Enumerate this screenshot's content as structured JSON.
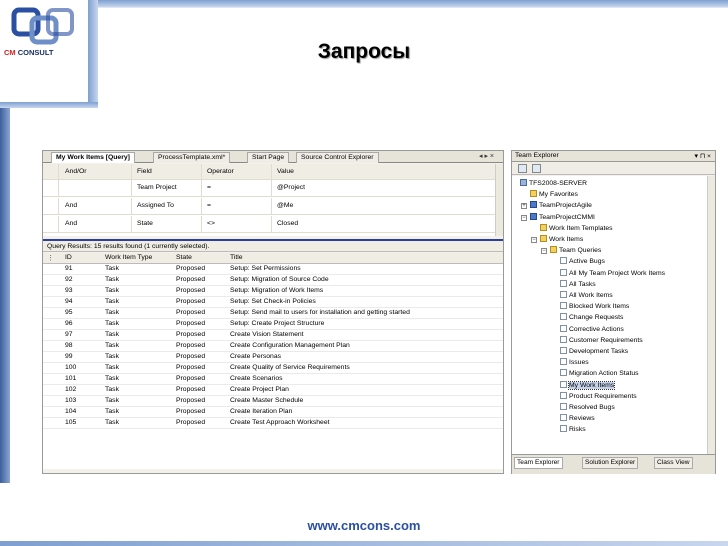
{
  "slide": {
    "title": "Запросы",
    "footer_url": "www.cmcons.com",
    "logo_text_cm": "CM",
    "logo_text_rest": " CONSULT"
  },
  "left_panel": {
    "tabs": [
      "My Work Items [Query]",
      "ProcessTemplate.xml*",
      "Start Page",
      "Source Control Explorer"
    ],
    "tab_controls": "◂ ▸ ×",
    "query_grid": {
      "headers": [
        "And/Or",
        "Field",
        "Operator",
        "Value"
      ],
      "rows": [
        [
          "",
          "Team Project",
          "=",
          "@Project"
        ],
        [
          "And",
          "Assigned To",
          "=",
          "@Me"
        ],
        [
          "And",
          "State",
          "<>",
          "Closed"
        ]
      ]
    },
    "results_summary": "Query Results: 15 results found (1 currently selected).",
    "results_headers": [
      "ID",
      "Work Item Type",
      "State",
      "Title"
    ],
    "results": [
      [
        "91",
        "Task",
        "Proposed",
        "Setup: Set Permissions"
      ],
      [
        "92",
        "Task",
        "Proposed",
        "Setup: Migration of Source Code"
      ],
      [
        "93",
        "Task",
        "Proposed",
        "Setup: Migration of Work Items"
      ],
      [
        "94",
        "Task",
        "Proposed",
        "Setup: Set Check-in Policies"
      ],
      [
        "95",
        "Task",
        "Proposed",
        "Setup: Send mail to users for installation and getting started"
      ],
      [
        "96",
        "Task",
        "Proposed",
        "Setup: Create Project Structure"
      ],
      [
        "97",
        "Task",
        "Proposed",
        "Create Vision Statement"
      ],
      [
        "98",
        "Task",
        "Proposed",
        "Create Configuration Management Plan"
      ],
      [
        "99",
        "Task",
        "Proposed",
        "Create Personas"
      ],
      [
        "100",
        "Task",
        "Proposed",
        "Create Quality of Service Requirements"
      ],
      [
        "101",
        "Task",
        "Proposed",
        "Create Scenarios"
      ],
      [
        "102",
        "Task",
        "Proposed",
        "Create Project Plan"
      ],
      [
        "103",
        "Task",
        "Proposed",
        "Create Master Schedule"
      ],
      [
        "104",
        "Task",
        "Proposed",
        "Create Iteration Plan"
      ],
      [
        "105",
        "Task",
        "Proposed",
        "Create Test Approach Worksheet"
      ]
    ]
  },
  "right_panel": {
    "title": "Team Explorer",
    "title_controls": "▾ ⊓ ×",
    "tree": [
      {
        "label": "TFS2008-SERVER",
        "icon": "server"
      },
      {
        "label": "My Favorites",
        "icon": "folder"
      },
      {
        "label": "TeamProjectAgile",
        "icon": "proj"
      },
      {
        "label": "TeamProjectCMMI",
        "icon": "proj"
      },
      {
        "label": "Work Item Templates",
        "icon": "folder"
      },
      {
        "label": "Work Items",
        "icon": "folder"
      },
      {
        "label": "Team Queries",
        "icon": "folder"
      },
      {
        "label": "Active Bugs",
        "icon": "query"
      },
      {
        "label": "All My Team Project Work Items",
        "icon": "query"
      },
      {
        "label": "All Tasks",
        "icon": "query"
      },
      {
        "label": "All Work Items",
        "icon": "query"
      },
      {
        "label": "Blocked Work Items",
        "icon": "query"
      },
      {
        "label": "Change Requests",
        "icon": "query"
      },
      {
        "label": "Corrective Actions",
        "icon": "query"
      },
      {
        "label": "Customer Requirements",
        "icon": "query"
      },
      {
        "label": "Development Tasks",
        "icon": "query"
      },
      {
        "label": "Issues",
        "icon": "query"
      },
      {
        "label": "Migration Action Status",
        "icon": "query"
      },
      {
        "label": "My Work Items",
        "icon": "query"
      },
      {
        "label": "Product Requirements",
        "icon": "query"
      },
      {
        "label": "Resolved Bugs",
        "icon": "query"
      },
      {
        "label": "Reviews",
        "icon": "query"
      },
      {
        "label": "Risks",
        "icon": "query"
      }
    ],
    "bottom_tabs": [
      "Team Explorer",
      "Solution Explorer",
      "Class View"
    ]
  },
  "colors": {
    "accent_blue": "#2b4fa3",
    "logo_red": "#d81e1e",
    "selection": "#c5d3ea"
  }
}
